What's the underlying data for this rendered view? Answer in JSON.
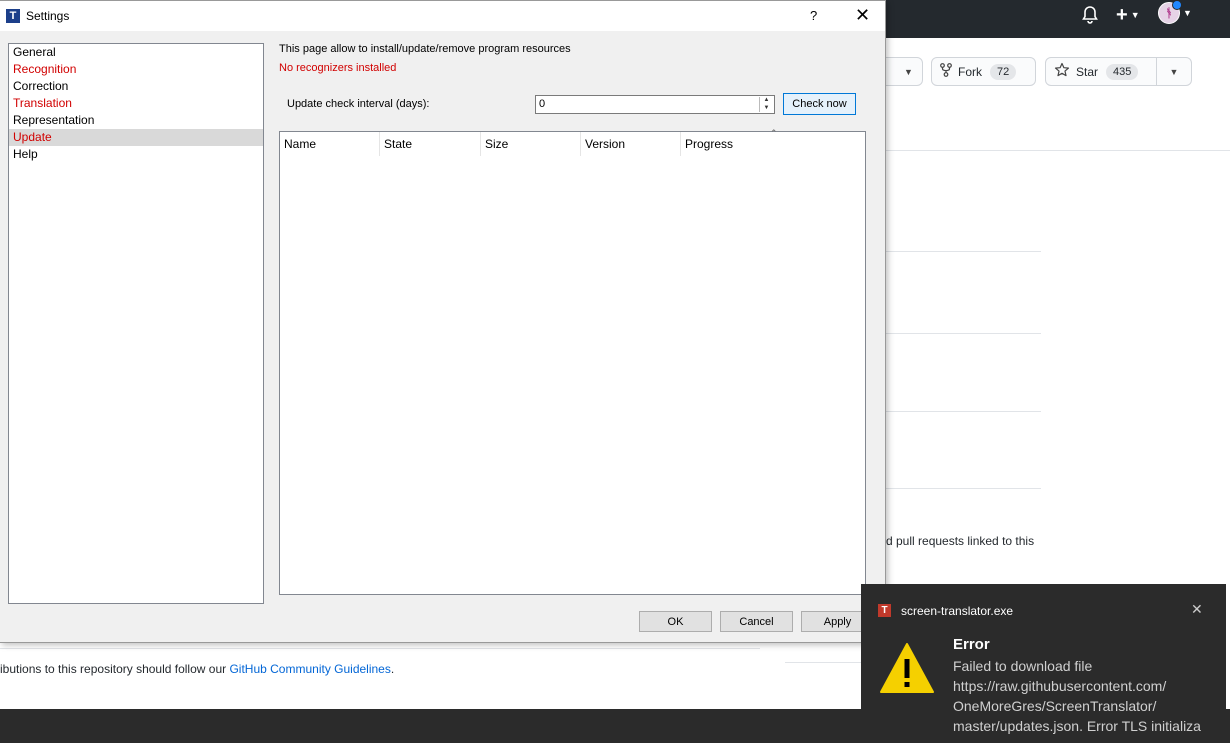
{
  "github": {
    "fork": {
      "label": "Fork",
      "count": "72"
    },
    "star": {
      "label": "Star",
      "count": "435"
    },
    "linked_text": "d pull requests linked to this",
    "guidelines_prefix": "ibutions to this repository should follow our ",
    "guidelines_link": "GitHub Community Guidelines",
    "guidelines_suffix": "."
  },
  "dialog": {
    "title": "Settings",
    "help": "?",
    "close": "✕",
    "nav": [
      "General",
      "Recognition",
      "Correction",
      "Translation",
      "Representation",
      "Update",
      "Help"
    ],
    "nav_error_items": [
      "Recognition",
      "Translation",
      "Update"
    ],
    "nav_selected": "Update",
    "description": "This page allow to install/update/remove program resources",
    "warning": "No recognizers installed",
    "interval_label": "Update check interval (days):",
    "interval_value": "0",
    "check_now": "Check now",
    "columns": [
      "Name",
      "State",
      "Size",
      "Version",
      "Progress"
    ],
    "ok": "OK",
    "cancel": "Cancel",
    "apply": "Apply"
  },
  "toast": {
    "app": "screen-translator.exe",
    "title": "Error",
    "lines": [
      "Failed to download file",
      "https://raw.githubusercontent.com/",
      "OneMoreGres/ScreenTranslator/",
      "master/updates.json. Error TLS initializa"
    ]
  },
  "colors": {
    "error": "#d10000",
    "accent": "#0078d7",
    "link": "#0366d6"
  }
}
